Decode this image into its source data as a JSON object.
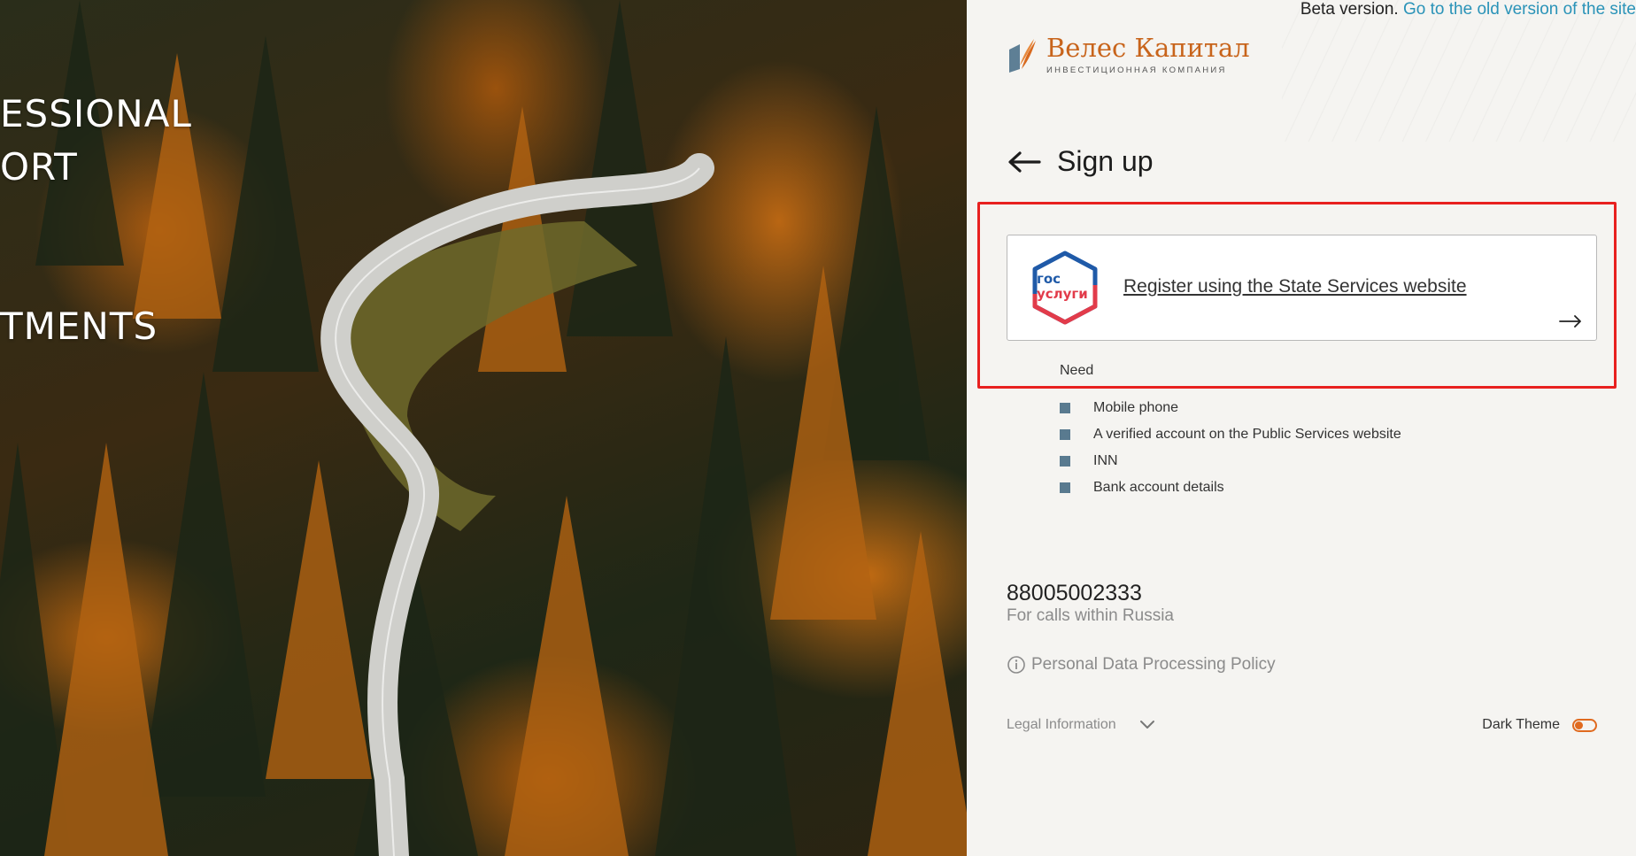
{
  "hero": {
    "line1": "ESSIONAL",
    "line2": "ORT",
    "line3": "TMENTS"
  },
  "header": {
    "beta_text": "Beta version.",
    "old_site_link": "Go to the old version of the site"
  },
  "logo": {
    "title": "Велес Капитал",
    "subtitle": "ИНВЕСТИЦИОННАЯ КОМПАНИЯ",
    "icon": "veles-logo-icon"
  },
  "signup": {
    "title": "Sign up",
    "back_icon": "arrow-left-icon"
  },
  "gosuslugi": {
    "logo_line1": "гос",
    "logo_line2": "услуги",
    "link_text": "Register using the State Services website",
    "arrow_icon": "arrow-right-icon"
  },
  "requirements": {
    "heading": "Need",
    "items": [
      "Mobile phone",
      "A verified account on the Public Services website",
      "INN",
      "Bank account details"
    ]
  },
  "contact": {
    "phone": "88005002333",
    "note": "For calls within Russia"
  },
  "policy": {
    "label": "Personal Data Processing Policy",
    "icon": "info-icon"
  },
  "footer": {
    "legal_label": "Legal Information",
    "legal_icon": "chevron-down-icon",
    "dark_theme_label": "Dark Theme",
    "dark_theme_on": false
  },
  "colors": {
    "accent": "#e06a1f",
    "link": "#2a93b8",
    "highlight_box": "#e8201f",
    "bullet": "#597a8f"
  }
}
